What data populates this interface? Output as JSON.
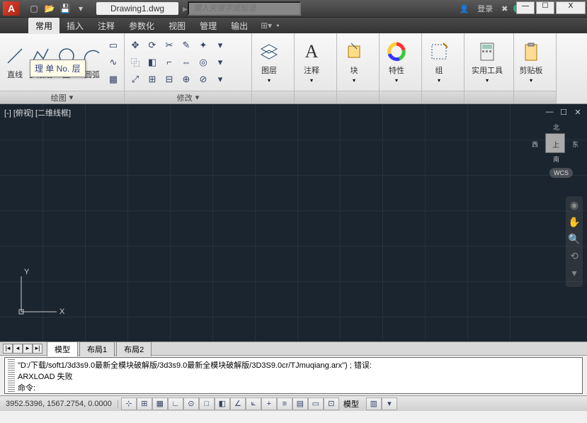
{
  "app": {
    "letter": "A"
  },
  "title": {
    "document": "Drawing1.dwg"
  },
  "search": {
    "placeholder": "键入关键字或短语"
  },
  "title_right": {
    "login": "登录"
  },
  "win": {
    "min": "—",
    "max": "☐",
    "close": "X"
  },
  "menu": {
    "tabs": [
      "常用",
      "插入",
      "注释",
      "参数化",
      "视图",
      "管理",
      "输出"
    ],
    "active_index": 0
  },
  "ribbon": {
    "panels": {
      "draw": {
        "title": "绘图",
        "labels": [
          "直线",
          "多段线",
          "圆",
          "圆弧"
        ]
      },
      "modify": {
        "title": "修改"
      },
      "layer": {
        "title": "图层"
      },
      "annotation": {
        "title": "注释"
      },
      "block": {
        "title": "块"
      },
      "properties": {
        "title": "特性"
      },
      "group": {
        "title": "组"
      },
      "utilities": {
        "title": "实用工具"
      },
      "clipboard": {
        "title": "剪贴板"
      }
    }
  },
  "tooltip": "理 单 No. 层",
  "canvas": {
    "viewlabel": "[-] [俯视] [二维线框]",
    "viewcube": {
      "n": "北",
      "s": "南",
      "e": "东",
      "w": "西",
      "face": "上"
    },
    "wcs": "WCS",
    "axis": {
      "x": "X",
      "y": "Y"
    }
  },
  "tabs": {
    "model": "模型",
    "layout1": "布局1",
    "layout2": "布局2"
  },
  "command": {
    "line1": "\"D:/下载/soft1/3d3s9.0最新全模块破解版/3d3s9.0最新全模块破解版/3D3S9.0cr/TJmuqiang.arx\") ; 错误:",
    "line2": "ARXLOAD 失败",
    "prompt": "命令:"
  },
  "status": {
    "coords": "3952.5396, 1567.2754, 0.0000",
    "space": "模型"
  }
}
